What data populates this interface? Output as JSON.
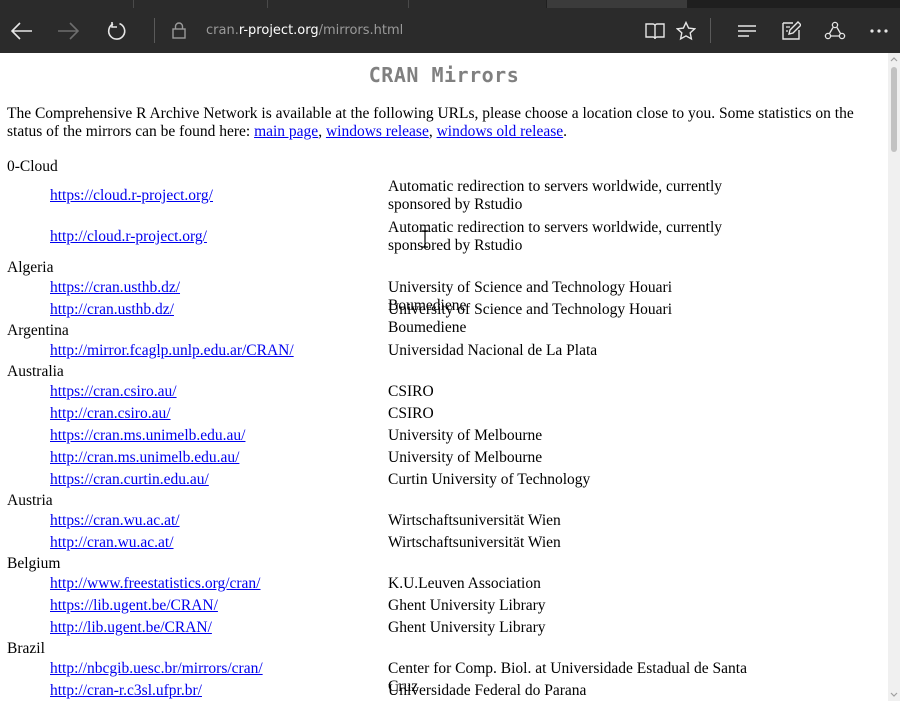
{
  "browser": {
    "url_prefix": "cran.",
    "url_host": "r-project.org",
    "url_path": "/mirrors.html"
  },
  "page": {
    "title": "CRAN Mirrors",
    "intro_text": "The Comprehensive R Archive Network is available at the following URLs, please choose a location close to you. Some statistics on the status of the mirrors can be found here: ",
    "links": [
      "main page",
      "windows release",
      "windows old release"
    ],
    "link_sep": ", ",
    "intro_end": "."
  },
  "mirrors": [
    {
      "country": "0-Cloud",
      "entries": [
        {
          "url": "https://cloud.r-project.org/",
          "desc": "Automatic redirection to servers worldwide, currently sponsored by Rstudio"
        },
        {
          "url": "http://cloud.r-project.org/",
          "desc": "Automatic redirection to servers worldwide, currently sponsored by Rstudio"
        }
      ]
    },
    {
      "country": "Algeria",
      "entries": [
        {
          "url": "https://cran.usthb.dz/",
          "desc": "University of Science and Technology Houari Boumediene"
        },
        {
          "url": "http://cran.usthb.dz/",
          "desc": "University of Science and Technology Houari Boumediene"
        }
      ]
    },
    {
      "country": "Argentina",
      "entries": [
        {
          "url": "http://mirror.fcaglp.unlp.edu.ar/CRAN/",
          "desc": "Universidad Nacional de La Plata"
        }
      ]
    },
    {
      "country": "Australia",
      "entries": [
        {
          "url": "https://cran.csiro.au/",
          "desc": "CSIRO"
        },
        {
          "url": "http://cran.csiro.au/",
          "desc": "CSIRO"
        },
        {
          "url": "https://cran.ms.unimelb.edu.au/",
          "desc": "University of Melbourne"
        },
        {
          "url": "http://cran.ms.unimelb.edu.au/",
          "desc": "University of Melbourne"
        },
        {
          "url": "https://cran.curtin.edu.au/",
          "desc": "Curtin University of Technology"
        }
      ]
    },
    {
      "country": "Austria",
      "entries": [
        {
          "url": "https://cran.wu.ac.at/",
          "desc": "Wirtschaftsuniversität Wien"
        },
        {
          "url": "http://cran.wu.ac.at/",
          "desc": "Wirtschaftsuniversität Wien"
        }
      ]
    },
    {
      "country": "Belgium",
      "entries": [
        {
          "url": "http://www.freestatistics.org/cran/",
          "desc": "K.U.Leuven Association"
        },
        {
          "url": "https://lib.ugent.be/CRAN/",
          "desc": "Ghent University Library"
        },
        {
          "url": "http://lib.ugent.be/CRAN/",
          "desc": "Ghent University Library"
        }
      ]
    },
    {
      "country": "Brazil",
      "entries": [
        {
          "url": "http://nbcgib.uesc.br/mirrors/cran/",
          "desc": "Center for Comp. Biol. at Universidade Estadual de Santa Cruz"
        },
        {
          "url": "http://cran-r.c3sl.ufpr.br/",
          "desc": "Universidade Federal do Parana"
        }
      ]
    }
  ],
  "colors": {
    "toolbar": "#2b2b2b",
    "link": "#0000ee",
    "title": "#808080"
  }
}
